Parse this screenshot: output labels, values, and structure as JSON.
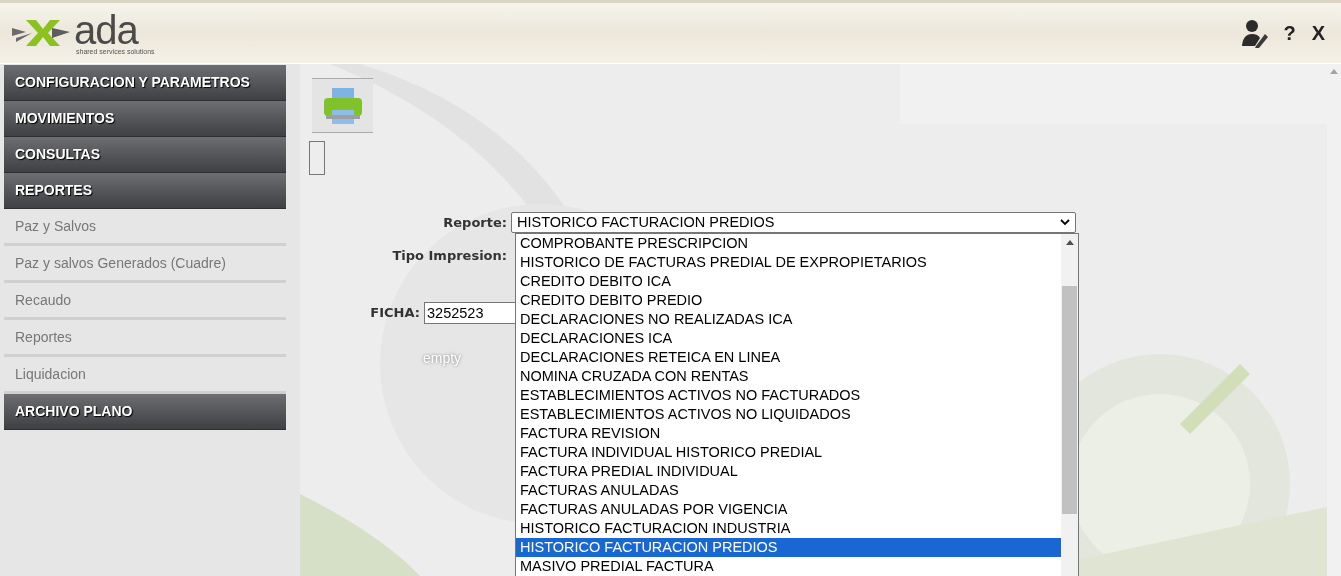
{
  "header": {
    "logo": {
      "name": "ada",
      "tagline": "shared services solutions"
    },
    "actions": [
      {
        "kind": "user-edit"
      },
      {
        "kind": "text",
        "label": "?"
      },
      {
        "kind": "text",
        "label": "X"
      }
    ]
  },
  "sidebar": {
    "items": [
      {
        "label": "CONFIGURACION Y PARAMETROS"
      },
      {
        "label": "MOVIMIENTOS"
      },
      {
        "label": "CONSULTAS"
      },
      {
        "label": "REPORTES",
        "children": [
          {
            "label": "Paz y Salvos"
          },
          {
            "label": "Paz y salvos Generados (Cuadre)"
          },
          {
            "label": "Recaudo"
          },
          {
            "label": "Reportes"
          },
          {
            "label": "Liquidacion"
          }
        ]
      },
      {
        "label": "ARCHIVO PLANO"
      }
    ]
  },
  "form": {
    "reporte": {
      "label": "Reporte:",
      "value": "HISTORICO FACTURACION PREDIOS",
      "options": [
        {
          "label": "COMPROBANTE PRESCRIPCION",
          "selected": false
        },
        {
          "label": "HISTORICO DE FACTURAS PREDIAL DE EXPROPIETARIOS",
          "selected": false
        },
        {
          "label": "CREDITO DEBITO ICA",
          "selected": false
        },
        {
          "label": "CREDITO DEBITO PREDIO",
          "selected": false
        },
        {
          "label": "DECLARACIONES NO REALIZADAS ICA",
          "selected": false
        },
        {
          "label": "DECLARACIONES ICA",
          "selected": false
        },
        {
          "label": "DECLARACIONES RETEICA EN LINEA",
          "selected": false
        },
        {
          "label": "NOMINA CRUZADA CON RENTAS",
          "selected": false
        },
        {
          "label": "ESTABLECIMIENTOS ACTIVOS NO FACTURADOS",
          "selected": false
        },
        {
          "label": "ESTABLECIMIENTOS ACTIVOS NO LIQUIDADOS",
          "selected": false
        },
        {
          "label": "FACTURA REVISION",
          "selected": false
        },
        {
          "label": "FACTURA INDIVIDUAL HISTORICO PREDIAL",
          "selected": false
        },
        {
          "label": "FACTURA PREDIAL INDIVIDUAL",
          "selected": false
        },
        {
          "label": "FACTURAS ANULADAS",
          "selected": false
        },
        {
          "label": "FACTURAS ANULADAS POR VIGENCIA",
          "selected": false
        },
        {
          "label": "HISTORICO FACTURACION INDUSTRIA",
          "selected": false
        },
        {
          "label": "HISTORICO FACTURACION PREDIOS",
          "selected": true
        },
        {
          "label": "MASIVO PREDIAL FACTURA",
          "selected": false
        }
      ]
    },
    "tipo_impresion": {
      "label": "Tipo Impresion:"
    },
    "ficha": {
      "label": "FICHA:",
      "value": "3252523"
    },
    "note": "empty"
  }
}
